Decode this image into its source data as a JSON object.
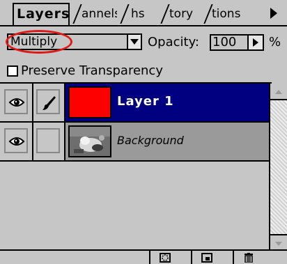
{
  "palette": {
    "tabs": [
      {
        "label": "Layers",
        "active": true
      },
      {
        "label": "annels",
        "active": false
      },
      {
        "label": "hs",
        "active": false
      },
      {
        "label": "tory",
        "active": false
      },
      {
        "label": "tions",
        "active": false
      }
    ],
    "menu_icon": "triangle-right-icon"
  },
  "blend_mode": {
    "value": "Multiply",
    "annotation_color": "#e01818"
  },
  "opacity": {
    "label": "Opacity:",
    "value": "100",
    "unit": "%"
  },
  "preserve_transparency": {
    "label": "Preserve Transparency",
    "checked": false
  },
  "layers": [
    {
      "name": "Layer 1",
      "selected": true,
      "visible": true,
      "brush": true,
      "thumb_color": "#ff0000"
    },
    {
      "name": "Background",
      "selected": false,
      "visible": true,
      "brush": false,
      "thumb": "photo"
    }
  ],
  "colors": {
    "panel": "#c6c6c6",
    "selected_row": "#000080",
    "unselected_row": "#9a9a9a"
  },
  "bottom_toolbar": [
    {
      "icon": "selection-mask-icon"
    },
    {
      "icon": "new-layer-icon"
    },
    {
      "icon": "trash-icon"
    }
  ]
}
